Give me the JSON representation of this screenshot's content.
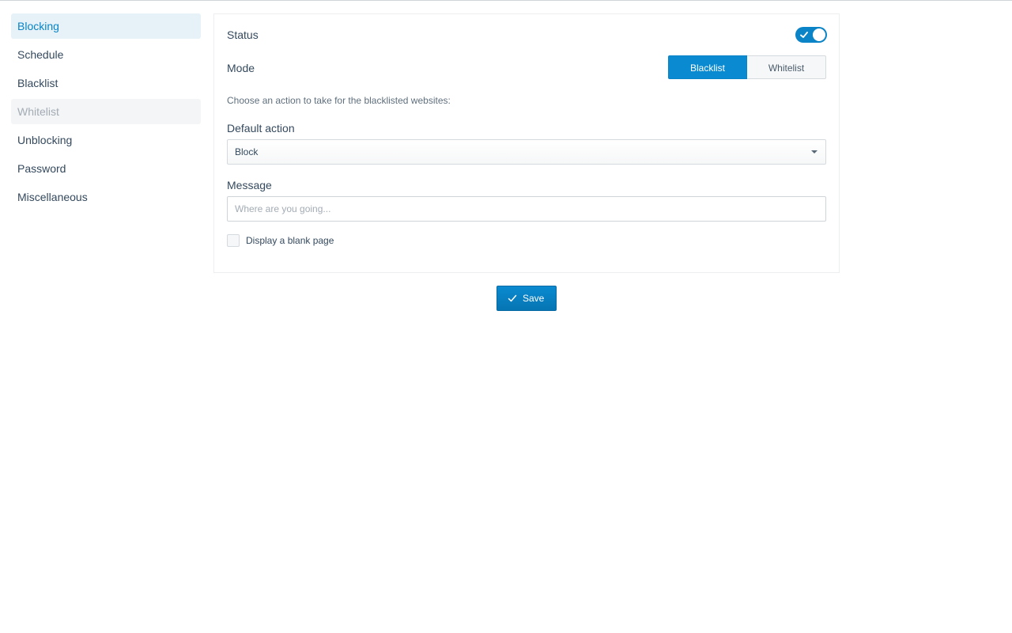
{
  "sidebar": {
    "items": [
      {
        "label": "Blocking",
        "state": "active"
      },
      {
        "label": "Schedule",
        "state": "normal"
      },
      {
        "label": "Blacklist",
        "state": "normal"
      },
      {
        "label": "Whitelist",
        "state": "disabled"
      },
      {
        "label": "Unblocking",
        "state": "normal"
      },
      {
        "label": "Password",
        "state": "normal"
      },
      {
        "label": "Miscellaneous",
        "state": "normal"
      }
    ]
  },
  "form": {
    "status_label": "Status",
    "status_on": true,
    "mode_label": "Mode",
    "mode_options": [
      "Blacklist",
      "Whitelist"
    ],
    "mode_selected": "Blacklist",
    "hint": "Choose an action to take for the blacklisted websites:",
    "default_action_label": "Default action",
    "default_action_value": "Block",
    "message_label": "Message",
    "message_value": "",
    "message_placeholder": "Where are you going...",
    "blank_page_label": "Display a blank page",
    "blank_page_checked": false
  },
  "actions": {
    "save_label": "Save"
  },
  "colors": {
    "accent": "#0a84c6",
    "active_bg": "#e6f1f8",
    "text": "#34495e"
  },
  "icons": {
    "toggle": "check-icon",
    "save": "check-icon",
    "select": "caret-down-icon"
  }
}
